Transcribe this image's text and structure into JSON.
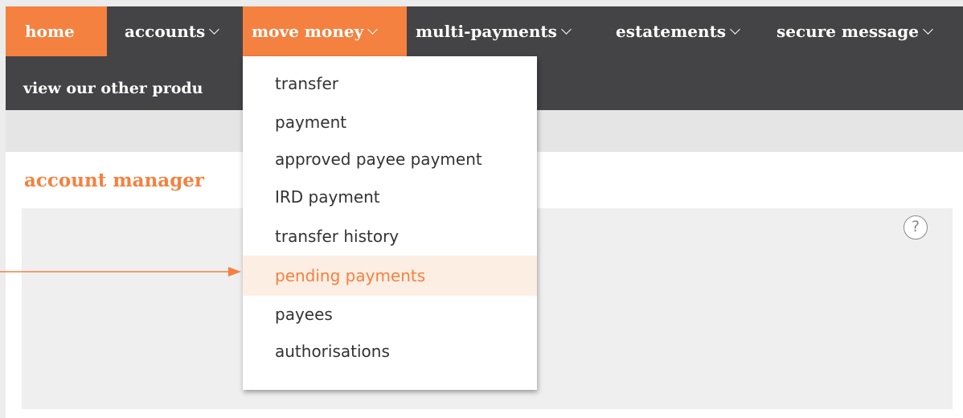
{
  "nav": {
    "items": [
      {
        "label": "home",
        "dropdown": false
      },
      {
        "label": "accounts",
        "dropdown": true
      },
      {
        "label": "move money",
        "dropdown": true
      },
      {
        "label": "multi-payments",
        "dropdown": true
      },
      {
        "label": "estatements",
        "dropdown": true
      },
      {
        "label": "secure message",
        "dropdown": true
      }
    ],
    "row2_label": "view our other produ"
  },
  "dropdown": {
    "items": [
      {
        "label": "transfer"
      },
      {
        "label": "payment"
      },
      {
        "label": "approved payee payment"
      },
      {
        "label": "IRD payment"
      },
      {
        "label": "transfer history"
      },
      {
        "label": "pending payments",
        "highlighted": true
      },
      {
        "label": "payees"
      },
      {
        "label": "authorisations"
      }
    ]
  },
  "main": {
    "section_title": "account manager",
    "help_icon_glyph": "?"
  },
  "colors": {
    "accent": "#f4813f",
    "nav_bg": "#444446",
    "highlight_bg": "#fdeee4"
  },
  "icons": [
    "chevron-down-icon",
    "help-icon",
    "arrow-right-icon"
  ]
}
